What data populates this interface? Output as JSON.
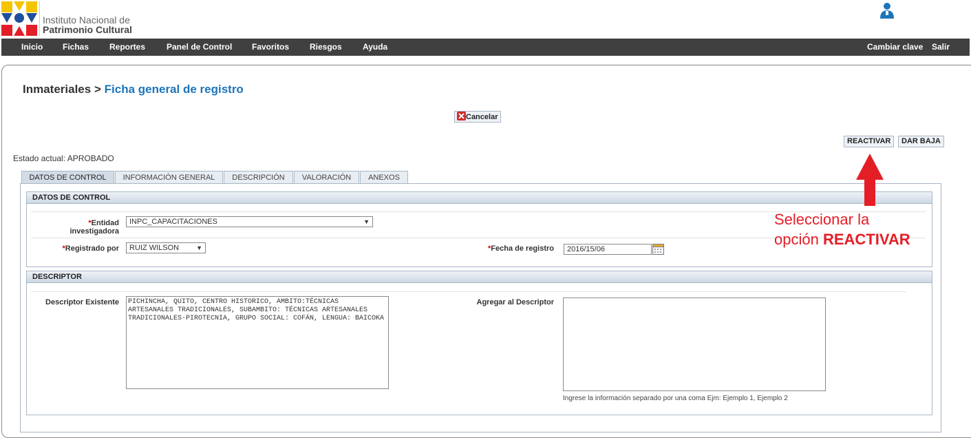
{
  "header": {
    "institution_line1": "Instituto Nacional de",
    "institution_line2": "Patrimonio Cultural",
    "logo_icon": "inpc-logo-icon",
    "user_icon": "user-icon"
  },
  "menu": {
    "items": [
      "Inicio",
      "Fichas",
      "Reportes",
      "Panel de Control",
      "Favoritos",
      "Riesgos",
      "Ayuda"
    ],
    "right": [
      "Cambiar clave",
      "Salir"
    ]
  },
  "breadcrumb": {
    "parent": "Inmateriales",
    "separator": ">",
    "current": "Ficha general de registro"
  },
  "buttons": {
    "cancel": "Cancelar",
    "reactivate": "REACTIVAR",
    "dar_baja": "DAR BAJA"
  },
  "estado": "Estado actual: APROBADO",
  "tabs": [
    "DATOS DE CONTROL",
    "INFORMACIÓN GENERAL",
    "DESCRIPCIÓN",
    "VALORACIÓN",
    "ANEXOS"
  ],
  "datos_control": {
    "title": "DATOS DE CONTROL",
    "entidad_label": "Entidad investigadora",
    "entidad_value": "INPC_CAPACITACIONES",
    "registrado_label": "Registrado por",
    "registrado_value": "RUIZ WILSON",
    "fecha_label": "Fecha de registro",
    "fecha_value": "2016/15/06"
  },
  "descriptor": {
    "title": "DESCRIPTOR",
    "existente_label": "Descriptor Existente",
    "existente_value": "PICHINCHA, QUITO, CENTRO HISTORICO, AMBITO:TÉCNICAS ARTESANALES TRADICIONALES, SUBAMBITO: TÉCNICAS ARTESANALES TRADICIONALES-PIROTECNIA, GRUPO SOCIAL: COFÁN, LENGUA: BAICOKA",
    "agregar_label": "Agregar al Descriptor",
    "agregar_value": "",
    "help": "Ingrese la información separado por una coma Ejm: Ejemplo 1, Ejemplo 2"
  },
  "annotation": {
    "line1": "Seleccionar la",
    "line2_prefix": "opción",
    "line2_bold": "REACTIVAR",
    "color": "#e41e26"
  }
}
